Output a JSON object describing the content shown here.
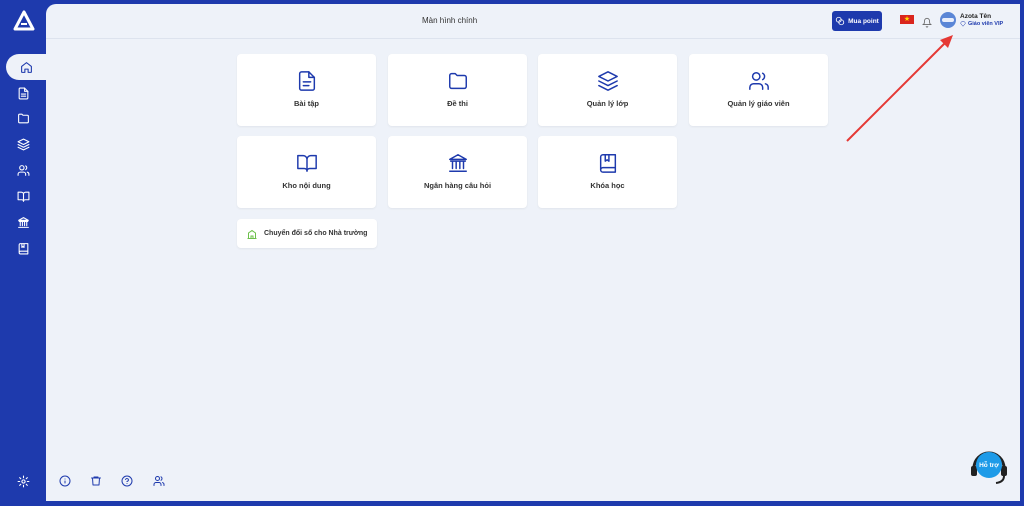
{
  "header": {
    "title": "Màn hình chính",
    "buy_point_label": "Mua point",
    "user_name": "Azota Tên",
    "user_role": "Giáo viên VIP"
  },
  "cards": [
    {
      "label": "Bài tập",
      "icon": "file-text-icon"
    },
    {
      "label": "Đề thi",
      "icon": "folder-icon"
    },
    {
      "label": "Quản lý lớp",
      "icon": "layers-icon"
    },
    {
      "label": "Quản lý giáo viên",
      "icon": "users-icon"
    },
    {
      "label": "Kho nội dung",
      "icon": "book-open-icon"
    },
    {
      "label": "Ngân hàng câu hỏi",
      "icon": "bank-icon"
    },
    {
      "label": "Khóa học",
      "icon": "book-icon"
    }
  ],
  "convert_button": {
    "label": "Chuyển đổi số cho Nhà trường",
    "icon": "school-icon"
  },
  "support": {
    "label": "Hỗ trợ"
  },
  "sidebar": {
    "items": [
      "home-icon",
      "file-text-icon",
      "folder-icon",
      "layers-icon",
      "users-icon",
      "book-open-icon",
      "bank-icon",
      "book-icon"
    ],
    "settings": "settings-icon"
  },
  "footer_icons": [
    "info-icon",
    "trash-icon",
    "help-icon",
    "users-icon"
  ],
  "colors": {
    "brand": "#1e3aad",
    "background": "#eef2f9",
    "annotation_arrow": "#e53935",
    "flag": "#da251d"
  }
}
